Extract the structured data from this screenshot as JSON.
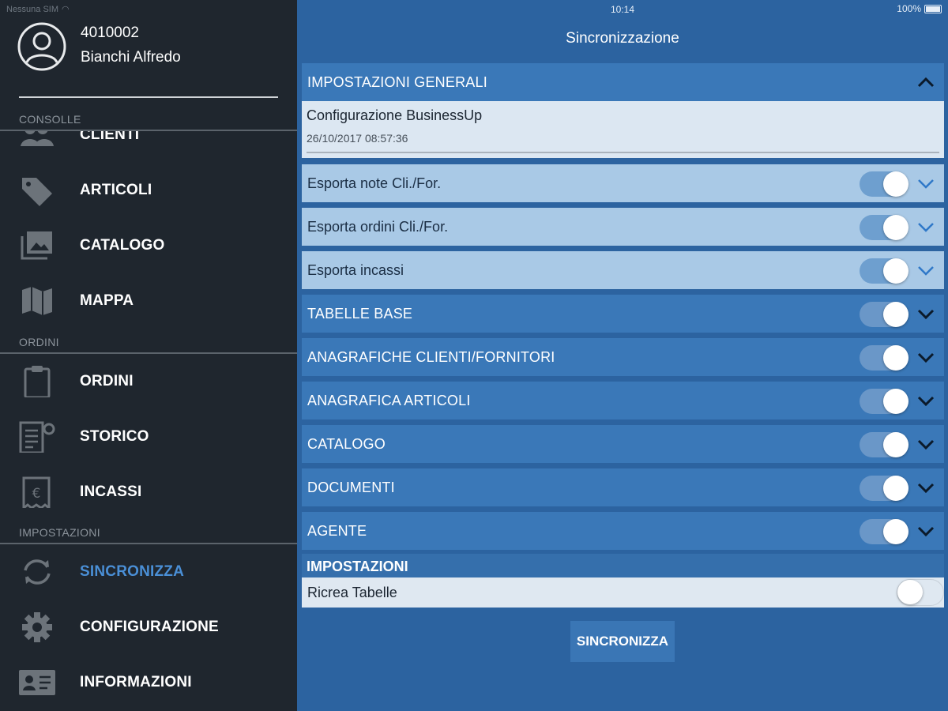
{
  "status_bar": {
    "carrier": "Nessuna SIM",
    "time": "10:14",
    "battery": "100%"
  },
  "profile": {
    "id": "4010002",
    "name": "Bianchi Alfredo"
  },
  "sidebar": {
    "sections": [
      {
        "label": "CONSOLLE",
        "items": [
          {
            "label": "CLIENTI",
            "icon": "clients-icon"
          },
          {
            "label": "ARTICOLI",
            "icon": "tag-icon"
          },
          {
            "label": "CATALOGO",
            "icon": "photos-icon"
          },
          {
            "label": "MAPPA",
            "icon": "map-icon"
          }
        ]
      },
      {
        "label": "ORDINI",
        "items": [
          {
            "label": "ORDINI",
            "icon": "clipboard-icon"
          },
          {
            "label": "STORICO",
            "icon": "history-icon"
          },
          {
            "label": "INCASSI",
            "icon": "receipt-euro-icon"
          }
        ]
      },
      {
        "label": "IMPOSTAZIONI",
        "items": [
          {
            "label": "SINCRONIZZA",
            "icon": "sync-icon",
            "active": true
          },
          {
            "label": "CONFIGURAZIONE",
            "icon": "gear-icon"
          },
          {
            "label": "INFORMAZIONI",
            "icon": "id-card-icon"
          }
        ]
      }
    ]
  },
  "main": {
    "title": "Sincronizzazione",
    "general_header": "IMPOSTAZIONI GENERALI",
    "config": {
      "title": "Configurazione BusinessUp",
      "date": "26/10/2017 08:57:36"
    },
    "sub_rows": [
      {
        "label": "Esporta note Cli./For.",
        "on": true
      },
      {
        "label": "Esporta ordini Cli./For.",
        "on": true
      },
      {
        "label": "Esporta incassi",
        "on": true
      }
    ],
    "sections": [
      {
        "label": "TABELLE BASE",
        "on": true
      },
      {
        "label": "ANAGRAFICHE CLIENTI/FORNITORI",
        "on": true
      },
      {
        "label": "ANAGRAFICA ARTICOLI",
        "on": true
      },
      {
        "label": "CATALOGO",
        "on": true
      },
      {
        "label": "DOCUMENTI",
        "on": true
      },
      {
        "label": "AGENTE",
        "on": true
      }
    ],
    "impostazioni_label": "IMPOSTAZIONI",
    "ricrea": {
      "label": "Ricrea Tabelle",
      "on": false
    },
    "sync_button": "SINCRONIZZA"
  },
  "colors": {
    "sidebar_bg": "#1f262e",
    "main_bg": "#2c63a0",
    "header_row": "#3a78b8",
    "sub_row": "#a9c9e6",
    "active_nav": "#4a8fd6"
  }
}
